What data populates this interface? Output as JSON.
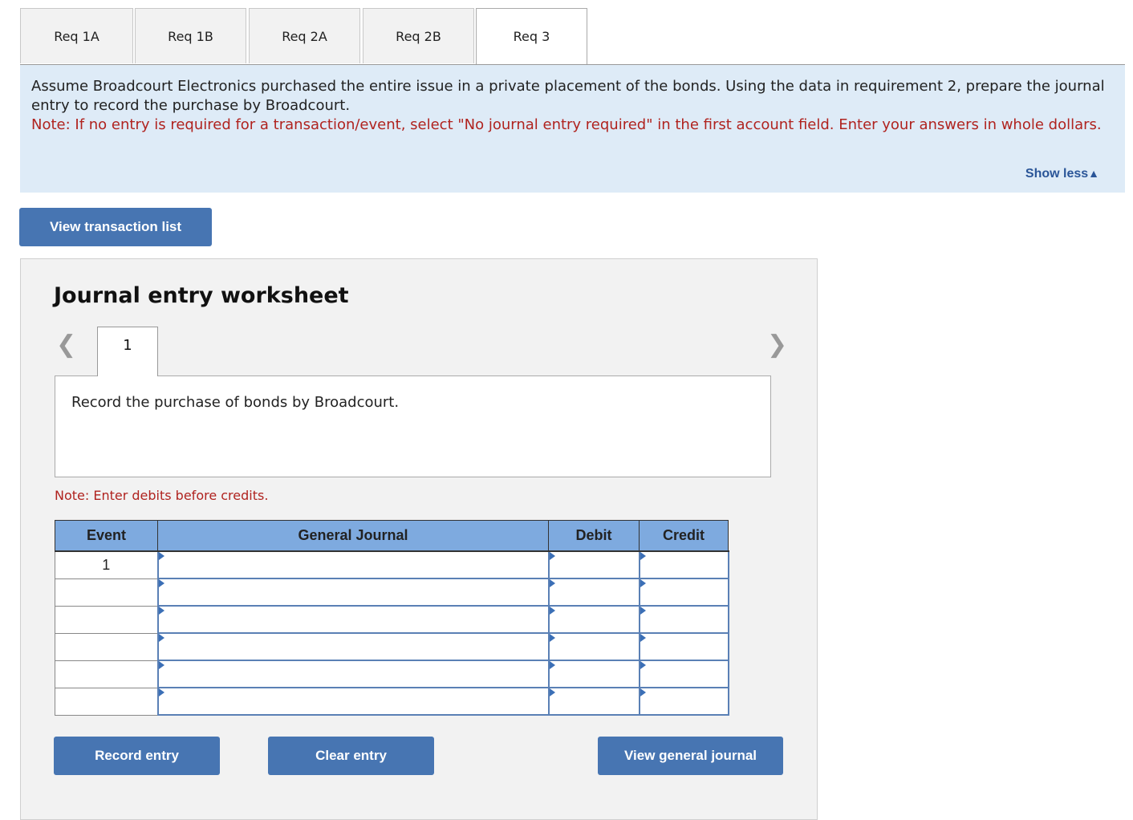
{
  "tabs": [
    {
      "label": "Req 1A",
      "active": false
    },
    {
      "label": "Req 1B",
      "active": false
    },
    {
      "label": "Req 2A",
      "active": false
    },
    {
      "label": "Req 2B",
      "active": false
    },
    {
      "label": "Req 3",
      "active": true
    }
  ],
  "instructions": {
    "text": "Assume Broadcourt Electronics purchased the entire issue in a private placement of the bonds. Using the data in requirement 2, prepare the journal entry to record the purchase by Broadcourt.",
    "note": "Note: If no entry is required for a transaction/event, select \"No journal entry required\" in the first account field. Enter your answers in whole dollars.",
    "show_less_label": "Show less",
    "show_less_icon": "triangle-up-icon"
  },
  "view_transaction_list_label": "View transaction list",
  "worksheet": {
    "title": "Journal entry worksheet",
    "prev_icon": "chevron-left-icon",
    "next_icon": "chevron-right-icon",
    "entry_tab": "1",
    "description": "Record the purchase of bonds by Broadcourt.",
    "note": "Note: Enter debits before credits.",
    "columns": [
      "Event",
      "General Journal",
      "Debit",
      "Credit"
    ],
    "rows": [
      {
        "event": "1",
        "account": "",
        "debit": "",
        "credit": ""
      },
      {
        "event": "",
        "account": "",
        "debit": "",
        "credit": ""
      },
      {
        "event": "",
        "account": "",
        "debit": "",
        "credit": ""
      },
      {
        "event": "",
        "account": "",
        "debit": "",
        "credit": ""
      },
      {
        "event": "",
        "account": "",
        "debit": "",
        "credit": ""
      },
      {
        "event": "",
        "account": "",
        "debit": "",
        "credit": ""
      }
    ],
    "buttons": {
      "record": "Record entry",
      "clear": "Clear entry",
      "view_journal": "View general journal"
    }
  }
}
